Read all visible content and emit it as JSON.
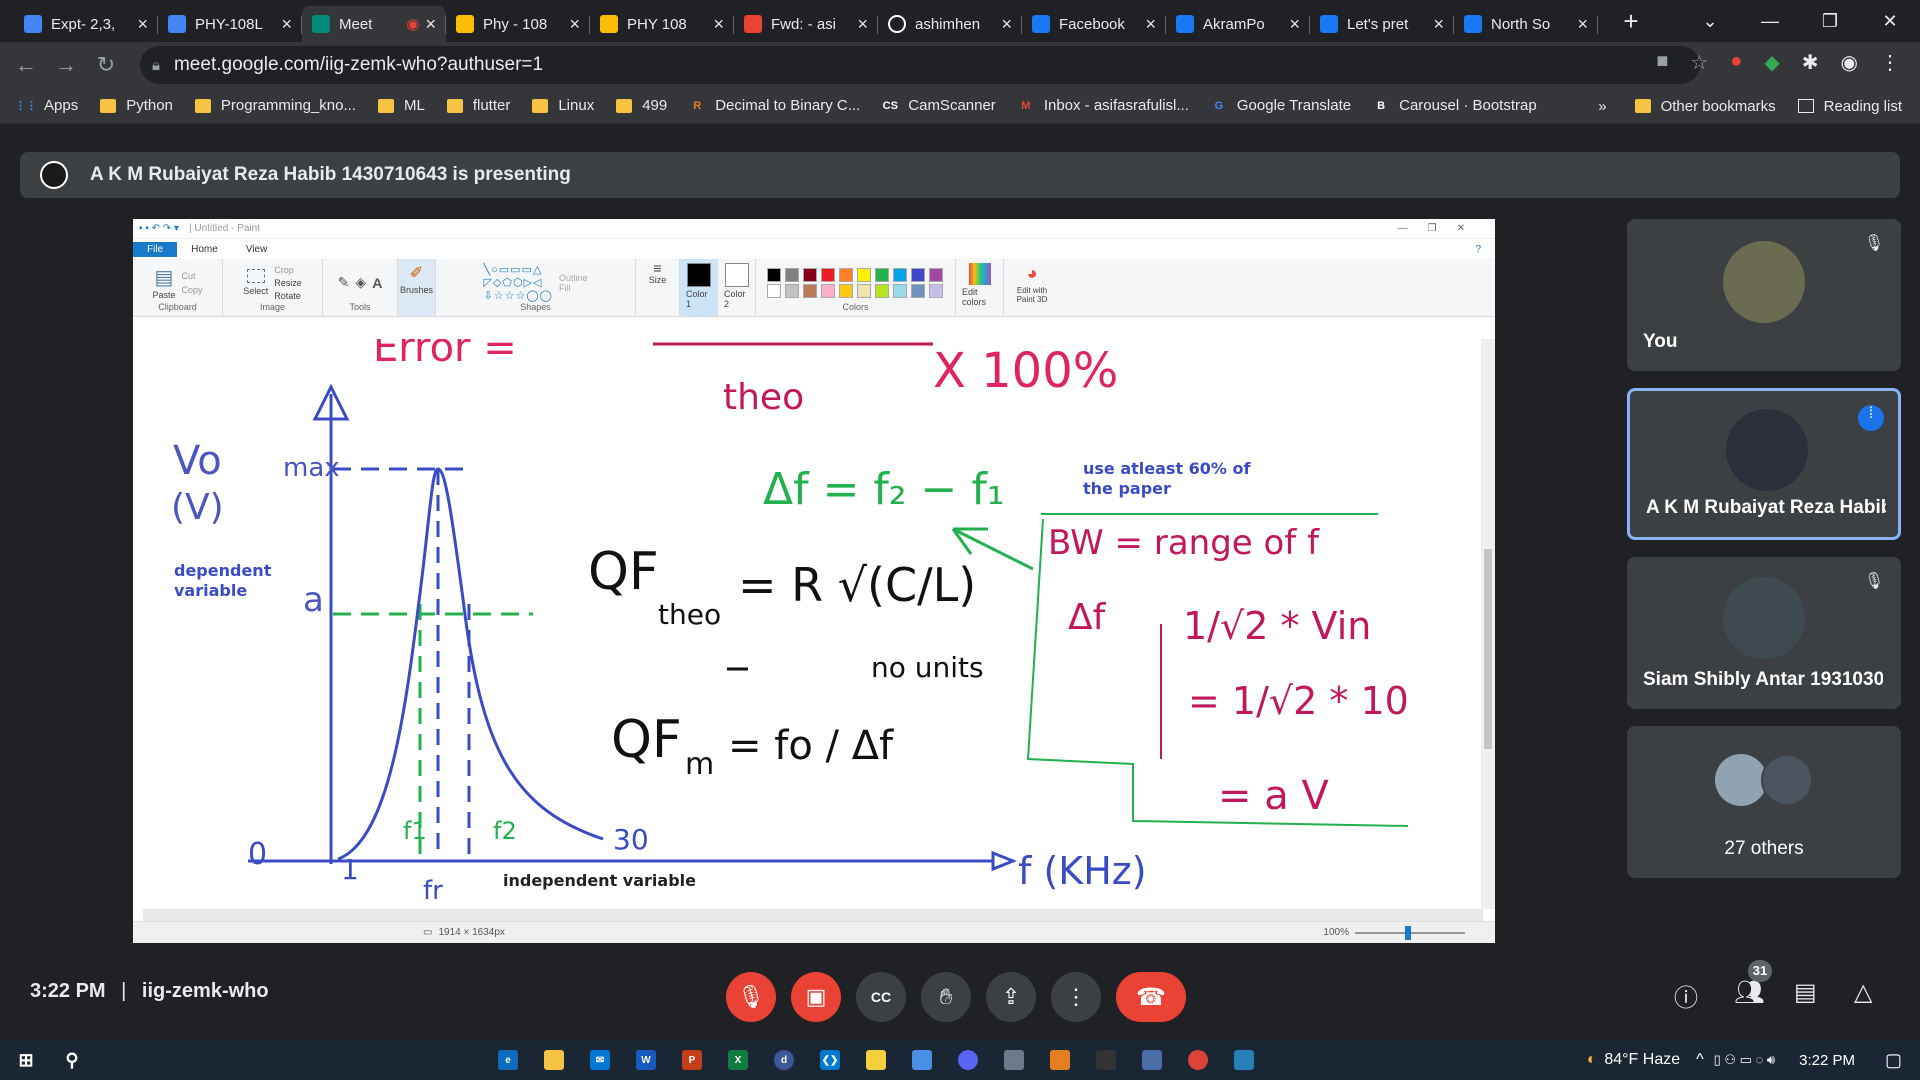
{
  "tabs": [
    {
      "title": "Expt- 2,3,",
      "icon": "docs-icon",
      "color": "#4285f4"
    },
    {
      "title": "PHY-108L",
      "icon": "docs-icon",
      "color": "#4285f4"
    },
    {
      "title": "Meet",
      "icon": "meet-icon",
      "color": "#00897b",
      "active": true
    },
    {
      "title": "Phy - 108",
      "icon": "drive-icon",
      "color": "#fbbc04"
    },
    {
      "title": "PHY 108",
      "icon": "drive-icon",
      "color": "#fbbc04"
    },
    {
      "title": "Fwd: - asi",
      "icon": "gmail-icon",
      "color": "#ea4335"
    },
    {
      "title": "ashimhen",
      "icon": "github-icon",
      "color": "#ffffff"
    },
    {
      "title": "Facebook",
      "icon": "facebook-icon",
      "color": "#1877f2"
    },
    {
      "title": "AkramPo",
      "icon": "facebook-icon",
      "color": "#1877f2"
    },
    {
      "title": "Let's pret",
      "icon": "facebook-icon",
      "color": "#1877f2"
    },
    {
      "title": "North So",
      "icon": "facebook-icon",
      "color": "#1877f2"
    }
  ],
  "url": "meet.google.com/iig-zemk-who?authuser=1",
  "bookmarks": [
    {
      "label": "Apps",
      "icon": "apps-icon"
    },
    {
      "label": "Python",
      "icon": "folder-icon"
    },
    {
      "label": "Programming_kno...",
      "icon": "folder-icon"
    },
    {
      "label": "ML",
      "icon": "folder-icon"
    },
    {
      "label": "flutter",
      "icon": "folder-icon"
    },
    {
      "label": "Linux",
      "icon": "folder-icon"
    },
    {
      "label": "499",
      "icon": "folder-icon"
    },
    {
      "label": "Decimal to Binary C...",
      "icon": "r-icon"
    },
    {
      "label": "CamScanner",
      "icon": "cs-icon"
    },
    {
      "label": "Inbox - asifasrafulisl...",
      "icon": "gmail-icon"
    },
    {
      "label": "Google Translate",
      "icon": "translate-icon"
    },
    {
      "label": "Carousel · Bootstrap",
      "icon": "bootstrap-icon"
    }
  ],
  "bookmarks_right": {
    "more": "»",
    "other": "Other bookmarks",
    "reading": "Reading list"
  },
  "presenting": "A K M Rubaiyat Reza Habib 1430710643 is presenting",
  "paint": {
    "title": "| Untitled - Paint",
    "tab_file": "File",
    "tab_home": "Home",
    "tab_view": "View",
    "groups": {
      "clipboard": "Clipboard",
      "image": "Image",
      "tools": "Tools",
      "shapes": "Shapes",
      "colors": "Colors"
    },
    "buttons": {
      "paste": "Paste",
      "cut": "Cut",
      "copy": "Copy",
      "select": "Select",
      "crop": "Crop",
      "resize": "Resize",
      "rotate": "Rotate",
      "brushes": "Brushes",
      "outline": "Outline",
      "fill": "Fill",
      "size": "Size",
      "color1": "Color 1",
      "color2": "Color 2",
      "edit_colors": "Edit colors",
      "edit_paint3d": "Edit with Paint 3D"
    },
    "palette": [
      "#000000",
      "#7f7f7f",
      "#880015",
      "#ed1c24",
      "#ff7f27",
      "#fff200",
      "#22b14c",
      "#00a2e8",
      "#3f48cc",
      "#a349a4",
      "#ffffff",
      "#c3c3c3",
      "#b97a57",
      "#ffaec9",
      "#ffc90e",
      "#efe4b0",
      "#b5e61d",
      "#99d9ea",
      "#7092be",
      "#c8bfe7"
    ],
    "status_size": "1914 × 1634px",
    "zoom": "100%"
  },
  "whiteboard": {
    "vo_label": "Vo",
    "v_unit": "(V)",
    "dependent": [
      "dependent",
      "variable"
    ],
    "max": "max",
    "a": "a",
    "independent": "independent variable",
    "note": [
      "use atleast 60% of",
      "the paper"
    ],
    "delta_f": "Δf = f₂ − f₁",
    "qf_theo": "QF",
    "theo": "theo",
    "r_sqrt": "= R √(C/L)",
    "no_units": "no units",
    "qf_m": "QF",
    "m_sub": "m",
    "fo_over_df": "= fo / Δf",
    "bw": "BW = range of f",
    "df": "Δf",
    "v1": "1/√2 * Vin",
    "v2": "= 1/√2 * 10",
    "v3": "= a   V",
    "f_khz": "f (KHz)",
    "error": "Error =",
    "theo2": "theo",
    "x100": "X 100%",
    "zero": "0",
    "one": "1",
    "thirty": "30",
    "f1": "f1",
    "f2": "f2",
    "fr": "fr"
  },
  "participants": [
    {
      "name": "You",
      "avatar_color": "#6b6b52"
    },
    {
      "name": "A K M Rubaiyat Reza Habib ...",
      "avatar_color": "#2b2f3a"
    },
    {
      "name": "Siam Shibly Antar 19310300...",
      "avatar_color": "#3e4a4f"
    },
    {
      "name": "27 others",
      "avatar_color": "#5f7380"
    }
  ],
  "meeting": {
    "time": "3:22 PM",
    "code": "iig-zemk-who",
    "participant_count": "31"
  },
  "taskbar": {
    "weather": "84°F  Haze",
    "time": "3:22 PM"
  }
}
